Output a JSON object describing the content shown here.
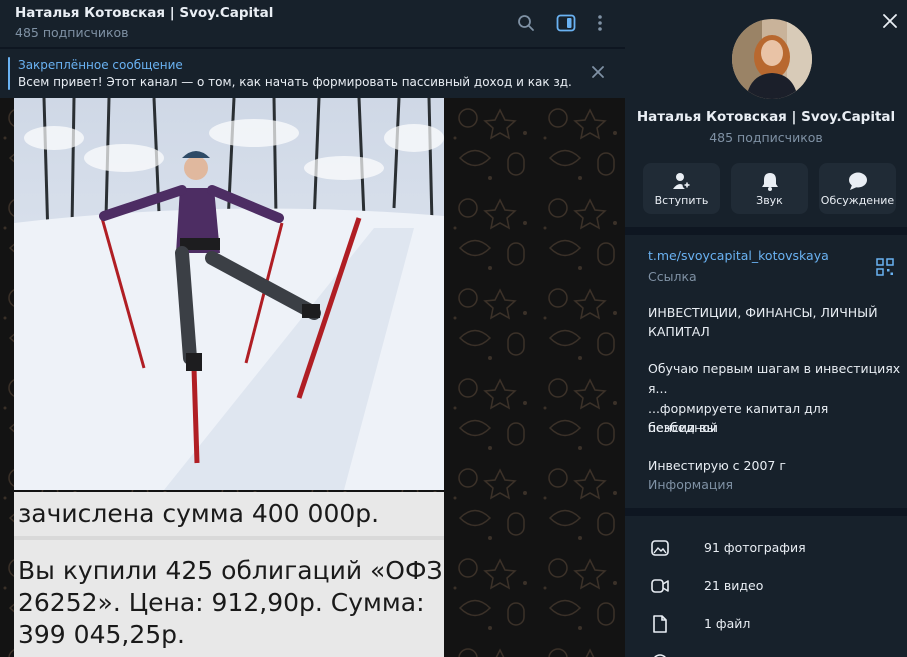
{
  "chat": {
    "title": "Наталья Котовская | Svoy.Capital",
    "subscribers": "485 подписчиков"
  },
  "pinned": {
    "label": "Закреплённое сообщение",
    "text": "Всем привет!  Этот канал — о том, как начать формировать пассивный доход и как зд..."
  },
  "message": {
    "line1": "зачислена сумма 400 000р.",
    "line2": "Вы купили 425 облигаций «ОФЗ",
    "line3": "26252». Цена: 912,90р. Сумма:",
    "line4": "399 045,25р."
  },
  "profile": {
    "name": "Наталья Котовская | Svoy.Capital",
    "subscribers": "485 подписчиков",
    "actions": [
      {
        "label": "Вступить",
        "icon": "add-user-icon"
      },
      {
        "label": "Звук",
        "icon": "bell-icon"
      },
      {
        "label": "Обсуждение",
        "icon": "chat-bubble-icon"
      }
    ],
    "link": "t.me/svoycapital_kotovskaya",
    "link_caption": "Ссылка",
    "description": {
      "line1": "ИНВЕСТИЦИИ, ФИНАНСЫ, ЛИЧНЫЙ",
      "line2": "КАПИТАЛ",
      "line3": "Обучаю первым шагам в инвестициях",
      "line4": "я...",
      "line5": "...формируете капитал для безбедной",
      "line6": "пенсии вы",
      "line7": "Инвестирую с 2007 г"
    },
    "info_caption": "Информация",
    "media": [
      {
        "label": "91 фотография",
        "icon": "photo-icon"
      },
      {
        "label": "21 видео",
        "icon": "video-icon"
      },
      {
        "label": "1 файл",
        "icon": "file-icon"
      }
    ]
  },
  "colors": {
    "accent": "#6ab2f2",
    "panel_bg": "#17212b",
    "chat_bg": "#0e1621"
  }
}
